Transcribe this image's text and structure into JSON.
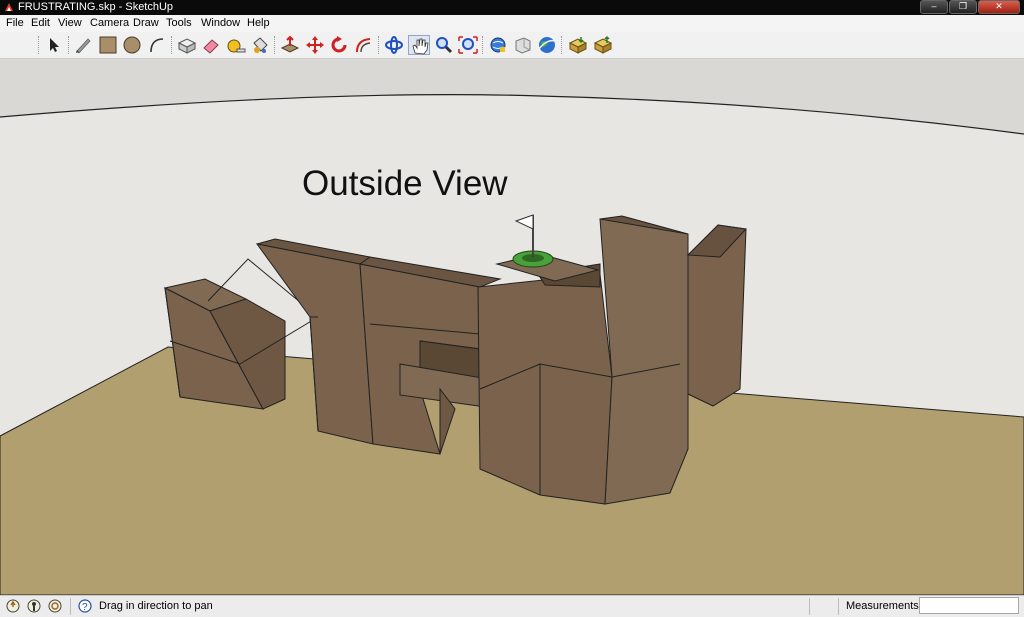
{
  "window": {
    "title": "FRUSTRATING.skp - SketchUp",
    "icon": "sketchup-logo-icon"
  },
  "menu": [
    "File",
    "Edit",
    "View",
    "Camera",
    "Draw",
    "Tools",
    "Window",
    "Help"
  ],
  "toolbar": {
    "tools": [
      "select-arrow-icon",
      "line-pencil-icon",
      "rectangle-icon",
      "circle-icon",
      "arc-icon",
      "make-component-icon",
      "eraser-icon",
      "tape-measure-icon",
      "paint-bucket-icon",
      "push-pull-icon",
      "move-icon",
      "rotate-icon",
      "offset-icon",
      "orbit-icon",
      "pan-hand-icon",
      "zoom-icon",
      "zoom-extents-icon",
      "get-models-icon",
      "share-model-icon",
      "google-earth-icon",
      "get-components-icon",
      "share-component-icon"
    ]
  },
  "scene": {
    "label": "Outside View",
    "colors": {
      "sky": "#d9d8d5",
      "ground": "#b19f6f",
      "wall": "#7a624c",
      "wall_light": "#806a54",
      "wall_dark": "#66523f",
      "flag_pad": "#4aa03a"
    }
  },
  "status": {
    "icons": [
      "geo-location-icon",
      "credits-icon",
      "user-sign-in-icon",
      "help-icon"
    ],
    "message": "Drag in direction to pan",
    "measurements_label": "Measurements",
    "measurements_value": ""
  }
}
